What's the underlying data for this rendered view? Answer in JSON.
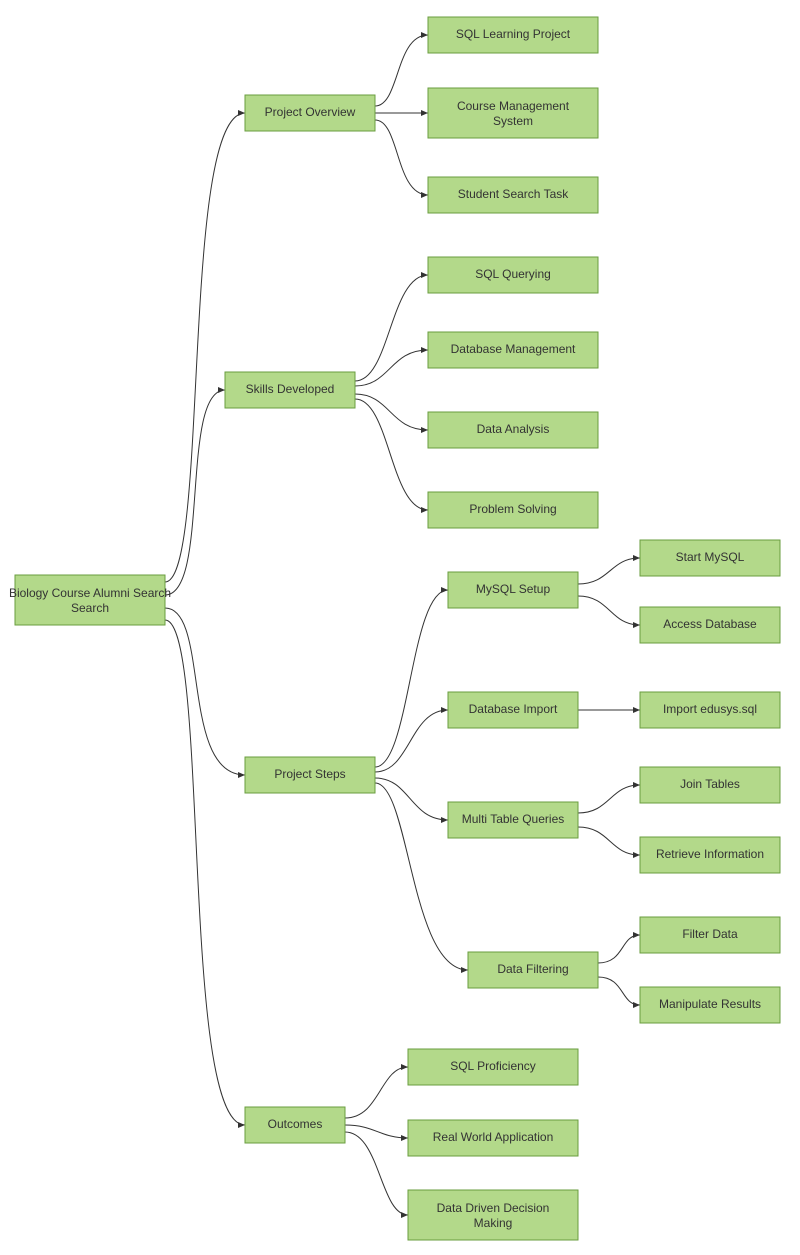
{
  "chart_data": {
    "type": "tree",
    "root": {
      "label": "Biology Course Alumni Search",
      "children": [
        {
          "label": "Project Overview",
          "children": [
            {
              "label": "SQL Learning Project"
            },
            {
              "label": "Course Management System"
            },
            {
              "label": "Student Search Task"
            }
          ]
        },
        {
          "label": "Skills Developed",
          "children": [
            {
              "label": "SQL Querying"
            },
            {
              "label": "Database Management"
            },
            {
              "label": "Data Analysis"
            },
            {
              "label": "Problem Solving"
            }
          ]
        },
        {
          "label": "Project Steps",
          "children": [
            {
              "label": "MySQL Setup",
              "children": [
                {
                  "label": "Start MySQL"
                },
                {
                  "label": "Access Database"
                }
              ]
            },
            {
              "label": "Database Import",
              "children": [
                {
                  "label": "Import edusys.sql"
                }
              ]
            },
            {
              "label": "Multi Table Queries",
              "children": [
                {
                  "label": "Join Tables"
                },
                {
                  "label": "Retrieve Information"
                }
              ]
            },
            {
              "label": "Data Filtering",
              "children": [
                {
                  "label": "Filter Data"
                },
                {
                  "label": "Manipulate Results"
                }
              ]
            }
          ]
        },
        {
          "label": "Outcomes",
          "children": [
            {
              "label": "SQL Proficiency"
            },
            {
              "label": "Real World Application"
            },
            {
              "label": "Data Driven Decision Making"
            }
          ]
        }
      ]
    }
  },
  "nodes": {
    "root": "Biology Course Alumni Search",
    "n1": "Project Overview",
    "n1a": "SQL Learning Project",
    "n1b": "Course Management System",
    "n1c": "Student Search Task",
    "n2": "Skills Developed",
    "n2a": "SQL Querying",
    "n2b": "Database Management",
    "n2c": "Data Analysis",
    "n2d": "Problem Solving",
    "n3": "Project Steps",
    "n3a": "MySQL Setup",
    "n3a1": "Start MySQL",
    "n3a2": "Access Database",
    "n3b": "Database Import",
    "n3b1": "Import edusys.sql",
    "n3c": "Multi Table Queries",
    "n3c1": "Join Tables",
    "n3c2": "Retrieve Information",
    "n3d": "Data Filtering",
    "n3d1": "Filter Data",
    "n3d2": "Manipulate Results",
    "n4": "Outcomes",
    "n4a": "SQL Proficiency",
    "n4b": "Real World Application",
    "n4c": "Data Driven Decision Making"
  }
}
